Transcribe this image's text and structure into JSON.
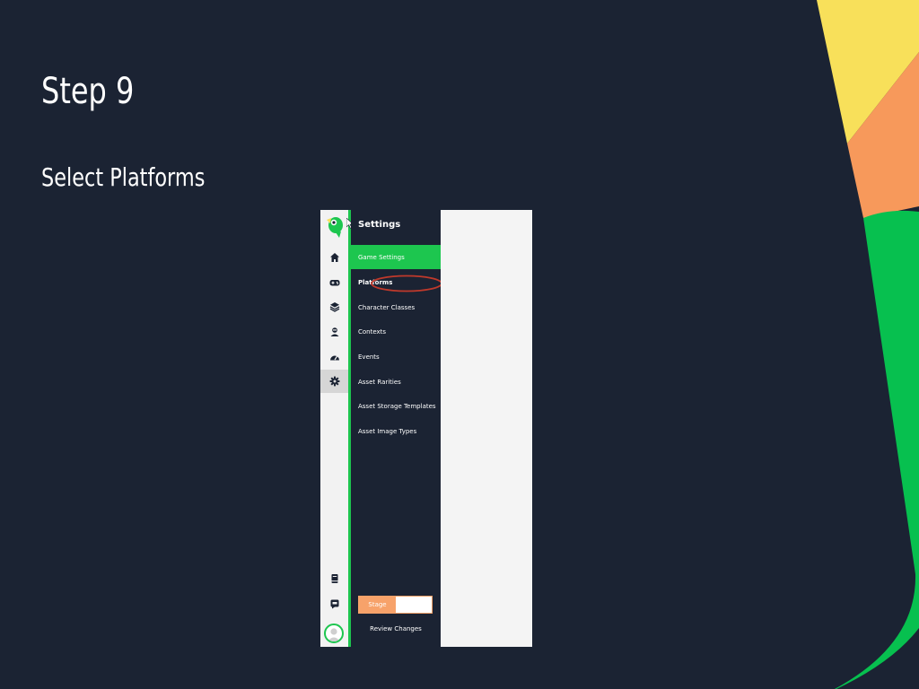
{
  "slide": {
    "title": "Step 9",
    "subtitle": "Select Platforms"
  },
  "colors": {
    "background": "#1b2333",
    "yellow": "#f8e05a",
    "orange": "#f7995b",
    "green": "#07c04f",
    "accent_green": "#1dc64f",
    "highlight_circle": "#c0392b",
    "stage_orange": "#f7a26a"
  },
  "screenshot": {
    "panel_title": "Settings",
    "rail_icons": [
      "home-icon",
      "gamepad-icon",
      "layers-icon",
      "contexts-icon",
      "dashboard-icon",
      "gear-icon",
      "book-icon",
      "chat-icon"
    ],
    "menu": [
      "Game Settings",
      "Platforms",
      "Character Classes",
      "Contexts",
      "Events",
      "Asset Rarities",
      "Asset Storage Templates",
      "Asset Image Types"
    ],
    "active_menu_item": "Game Settings",
    "highlighted_menu_item": "Platforms",
    "stage_label": "Stage",
    "review_changes": "Review Changes"
  }
}
